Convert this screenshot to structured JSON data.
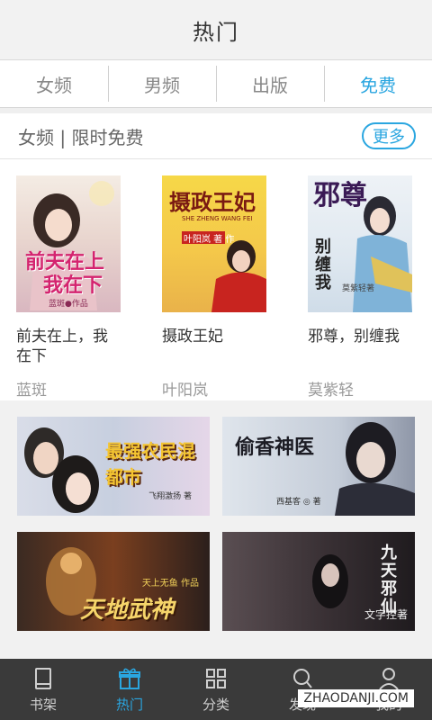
{
  "header": {
    "title": "热门"
  },
  "tabs": [
    {
      "label": "女频",
      "active": false
    },
    {
      "label": "男频",
      "active": false
    },
    {
      "label": "出版",
      "active": false
    },
    {
      "label": "免费",
      "active": true
    }
  ],
  "section": {
    "title": "女频 | 限时免费",
    "more_label": "更多"
  },
  "books": [
    {
      "title": "前夫在上，我在下",
      "author": "蓝斑",
      "cover_text_1": "前夫在上",
      "cover_text_2": "我在下",
      "cover_caption": "蓝斑●作品"
    },
    {
      "title": "摄政王妃",
      "author": "叶阳岚",
      "cover_text_1": "摄政王妃",
      "cover_text_2": "SHE ZHENG WANG FEI",
      "cover_caption": "叶阳岚 著 作"
    },
    {
      "title": "邪尊，别缠我",
      "author": "莫紫轻",
      "cover_text_1": "邪尊",
      "cover_text_2": "别缠我",
      "cover_caption": "莫紫轻著"
    }
  ],
  "banners": [
    {
      "text": "最强农民混都市",
      "caption": "飞翔激扬 著"
    },
    {
      "text": "偷香神医",
      "caption": "西基客 ◎ 著"
    },
    {
      "text": "天上无鱼 作品",
      "caption": "天地武神"
    },
    {
      "text": "九天邪仙",
      "caption": "文字控著"
    }
  ],
  "bottom_nav": [
    {
      "label": "书架",
      "icon": "bookshelf-icon",
      "active": false
    },
    {
      "label": "热门",
      "icon": "gift-icon",
      "active": true
    },
    {
      "label": "分类",
      "icon": "grid-icon",
      "active": false
    },
    {
      "label": "发现",
      "icon": "search-icon",
      "active": false
    },
    {
      "label": "我的",
      "icon": "user-icon",
      "active": false
    }
  ],
  "watermark": "ZHAODANJI.COM",
  "colors": {
    "accent": "#2aa6e0",
    "nav_bg": "#3a3a3a"
  }
}
